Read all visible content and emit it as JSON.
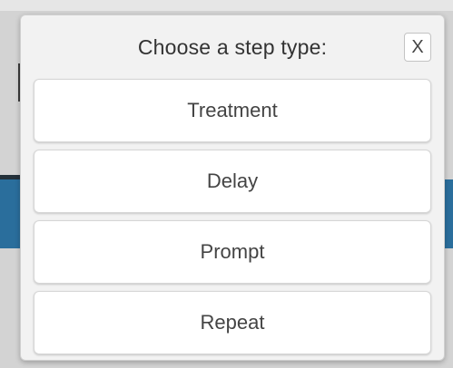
{
  "dialog": {
    "title": "Choose a step type:",
    "close_label": "X"
  },
  "options": [
    {
      "label": "Treatment"
    },
    {
      "label": "Delay"
    },
    {
      "label": "Prompt"
    },
    {
      "label": "Repeat"
    }
  ],
  "colors": {
    "dialog_background": "#f2f2f2",
    "button_background": "#ffffff",
    "text": "#444444",
    "backdrop_accent": "#2a6e9c"
  }
}
